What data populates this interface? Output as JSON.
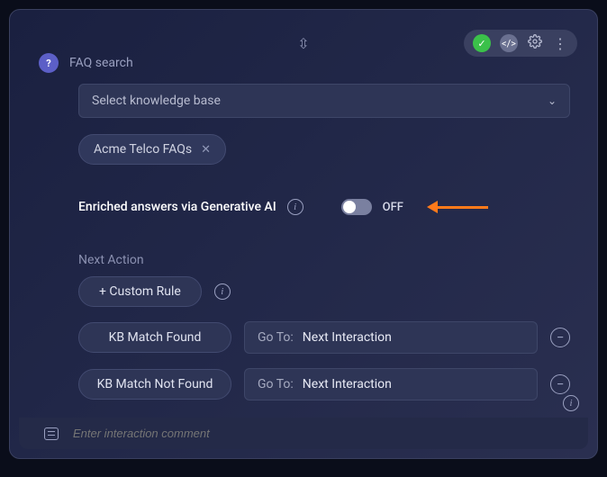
{
  "header": {
    "title": "FAQ search",
    "badge_text": "?"
  },
  "toolbar": {
    "status": "ok"
  },
  "kb_select": {
    "placeholder": "Select knowledge base",
    "selected_chip": "Acme Telco FAQs"
  },
  "enriched": {
    "label": "Enriched answers via Generative AI",
    "state": "OFF"
  },
  "next_action": {
    "section_label": "Next Action",
    "custom_rule_button": "+ Custom Rule",
    "goto_prefix": "Go To:",
    "rules": [
      {
        "label": "KB Match Found",
        "goto": "Next Interaction"
      },
      {
        "label": "KB Match Not Found",
        "goto": "Next Interaction"
      }
    ]
  },
  "comment": {
    "placeholder": "Enter interaction comment"
  }
}
